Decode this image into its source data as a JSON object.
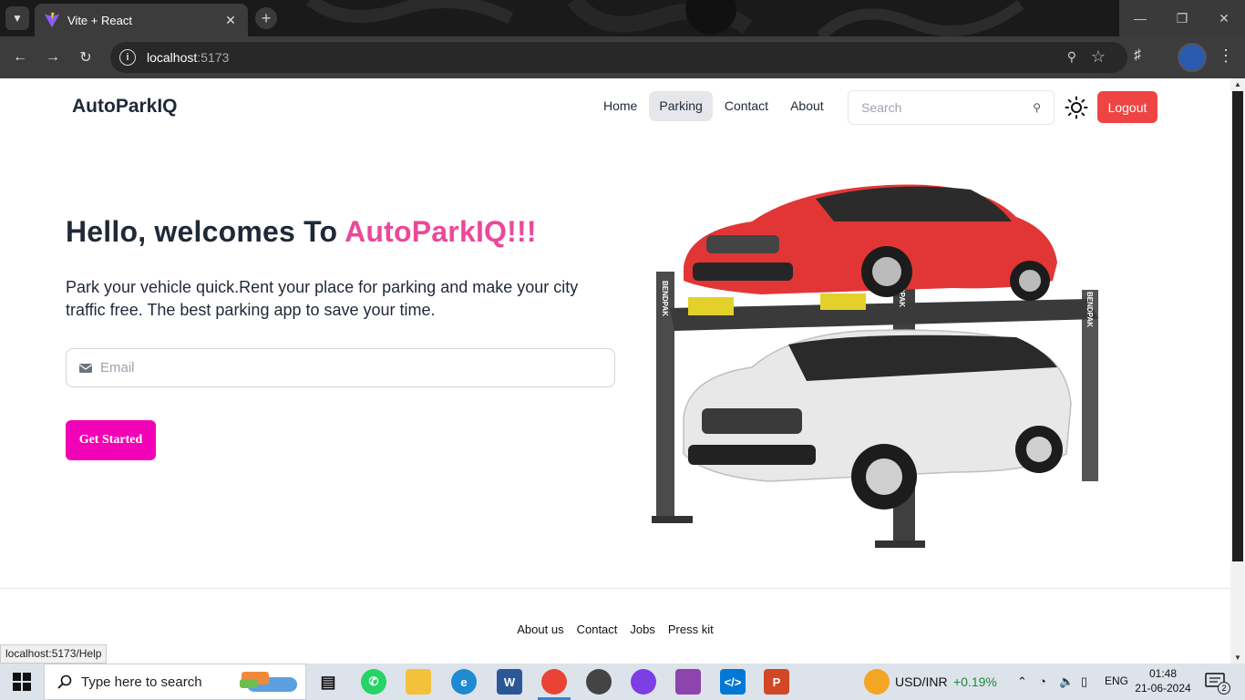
{
  "browser": {
    "tab_title": "Vite + React",
    "url_host": "localhost",
    "url_port": ":5173",
    "status_tooltip": "localhost:5173/Help"
  },
  "nav": {
    "brand": "AutoParkIQ",
    "links": [
      "Home",
      "Parking",
      "Contact",
      "About"
    ],
    "active_link": "Parking",
    "search_placeholder": "Search",
    "logout_label": "Logout",
    "accent_logout": "#ef4444"
  },
  "hero": {
    "title_prefix": "Hello, welcomes To",
    "title_accent": "AutoParkIQ!!!",
    "title_accent_color": "#ec4899",
    "description": "Park your vehicle quick.Rent your place for parking and make your city traffic free. The best parking app to save your time.",
    "email_placeholder": "Email",
    "cta_label": "Get Started",
    "cta_color": "#f202b6",
    "lift_brand": "BENDPAK"
  },
  "footer": {
    "links": [
      "About us",
      "Contact",
      "Jobs",
      "Press kit"
    ]
  },
  "taskbar": {
    "search_placeholder": "Type here to search",
    "ticker_label": "USD/INR",
    "ticker_change": "+0.19%",
    "language": "ENG",
    "time": "01:48",
    "date": "21-06-2024",
    "notification_count": "2"
  }
}
